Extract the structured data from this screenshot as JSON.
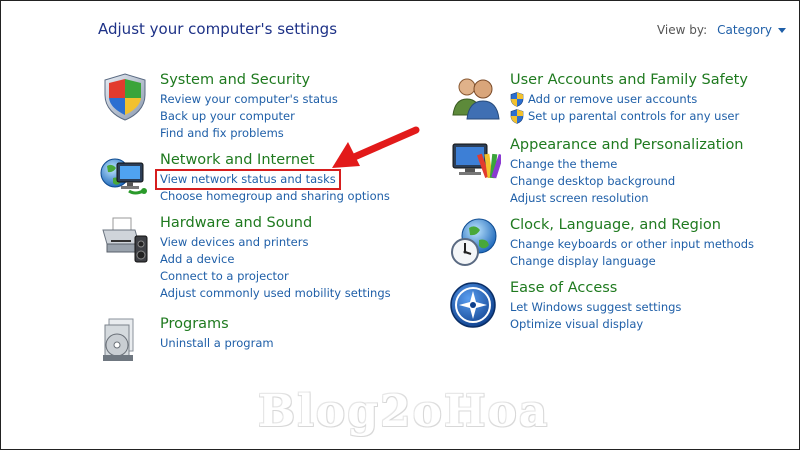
{
  "page": {
    "title": "Adjust your computer's settings"
  },
  "view_by": {
    "label": "View by:",
    "value": "Category"
  },
  "categories": [
    {
      "title": "System and Security",
      "icon": "shield-icon",
      "links": [
        "Review your computer's status",
        "Back up your computer",
        "Find and fix problems"
      ]
    },
    {
      "title": "Network and Internet",
      "icon": "network-icon",
      "links": [
        "View network status and tasks",
        "Choose homegroup and sharing options"
      ]
    },
    {
      "title": "Hardware and Sound",
      "icon": "printer-icon",
      "links": [
        "View devices and printers",
        "Add a device",
        "Connect to a projector",
        "Adjust commonly used mobility settings"
      ]
    },
    {
      "title": "Programs",
      "icon": "programs-icon",
      "links": [
        "Uninstall a program"
      ]
    },
    {
      "title": "User Accounts and Family Safety",
      "icon": "users-icon",
      "links": [
        "Add or remove user accounts",
        "Set up parental controls for any user"
      ]
    },
    {
      "title": "Appearance and Personalization",
      "icon": "appearance-icon",
      "links": [
        "Change the theme",
        "Change desktop background",
        "Adjust screen resolution"
      ]
    },
    {
      "title": "Clock, Language, and Region",
      "icon": "clock-globe-icon",
      "links": [
        "Change keyboards or other input methods",
        "Change display language"
      ]
    },
    {
      "title": "Ease of Access",
      "icon": "ease-of-access-icon",
      "links": [
        "Let Windows suggest settings",
        "Optimize visual display"
      ]
    }
  ],
  "watermark": "Blog2oHoa",
  "colors": {
    "title_blue": "#1e3287",
    "link_blue": "#1f5fa8",
    "category_green": "#1f7a1f",
    "highlight_red": "#d61e1e"
  }
}
